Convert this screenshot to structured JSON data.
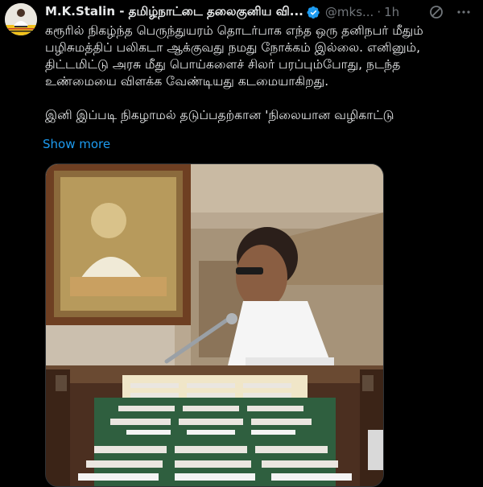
{
  "author": {
    "display_name": "M.K.Stalin - தமிழ்நாட்டை தலைகுனிய வி...",
    "handle": "@mks...",
    "separator": "·",
    "time": "1h",
    "verified_color": "#1d9bf0"
  },
  "post": {
    "paragraph_1": "கரூரில் நிகழ்ந்த பெருந்துயரம் தொடர்பாக எந்த ஒரு தனிநபர் மீதும் பழிசுமத்திப் பலிகடா ஆக்குவது நமது நோக்கம் இல்லை. எனினும், திட்டமிட்டு அரசு மீது பொய்களைச் சிலர் பரப்பும்போது, நடந்த உண்மையை விளக்க வேண்டியது கடமையாகிறது.",
    "paragraph_2": "இனி இப்படி நிகழாமல் தடுப்பதற்கான 'நிலையான வழிகாட்டு",
    "show_more": "Show more"
  },
  "icons": {
    "verified": "verified-badge-icon",
    "grok": "grok-icon",
    "more": "more-options-icon"
  },
  "colors": {
    "background": "#000000",
    "text": "#e7e9ea",
    "secondary_text": "#71767b",
    "link": "#1d9bf0"
  }
}
